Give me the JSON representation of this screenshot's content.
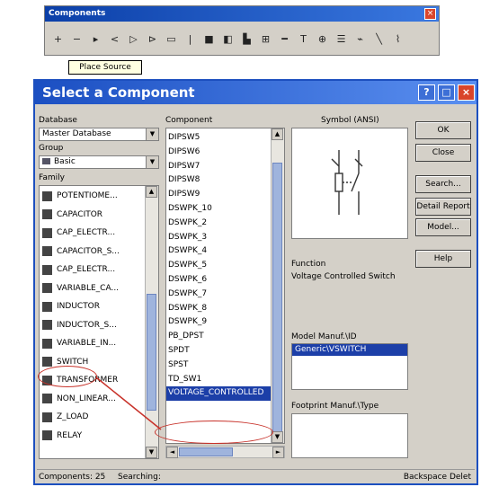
{
  "toolbar": {
    "title": "Components",
    "close_label": "×",
    "icons": [
      "plus-icon",
      "minus-icon",
      "diode-icon",
      "transistor-icon",
      "analog-icon",
      "ttl-icon",
      "cmos-icon",
      "misc-digital-icon",
      "mixed-icon",
      "indicator-icon",
      "power-icon",
      "misc-icon",
      "rf-icon",
      "electromech-icon",
      "ladder-icon",
      "mcu-icon",
      "bus-icon",
      "wire-icon",
      "probe-icon"
    ],
    "icon_glyphs": [
      "+",
      "−",
      "▸",
      "<",
      "▷",
      "⊳",
      "▭",
      "|",
      "■",
      "◧",
      "▙",
      "⊞",
      "━",
      "T",
      "⊕",
      "☰",
      "⌁",
      "╲",
      "⌇"
    ]
  },
  "tooltip": "Place Source",
  "window": {
    "title": "Select a Component",
    "database_label": "Database",
    "database_value": "Master Database",
    "group_label": "Group",
    "group_value": "Basic",
    "family_label": "Family",
    "families": [
      "POTENTIOME...",
      "CAPACITOR",
      "CAP_ELECTR...",
      "CAPACITOR_S...",
      "CAP_ELECTR...",
      "VARIABLE_CA...",
      "INDUCTOR",
      "INDUCTOR_S...",
      "VARIABLE_IN...",
      "SWITCH",
      "TRANSFORMER",
      "NON_LINEAR...",
      "Z_LOAD",
      "RELAY"
    ],
    "component_label": "Component",
    "components": [
      "DIPSW5",
      "DIPSW6",
      "DIPSW7",
      "DIPSW8",
      "DIPSW9",
      "DSWPK_10",
      "DSWPK_2",
      "DSWPK_3",
      "DSWPK_4",
      "DSWPK_5",
      "DSWPK_6",
      "DSWPK_7",
      "DSWPK_8",
      "DSWPK_9",
      "PB_DPST",
      "SPDT",
      "SPST",
      "TD_SW1",
      "VOLTAGE_CONTROLLED"
    ],
    "symbol_label": "Symbol (ANSI)",
    "function_label": "Function",
    "function_value": "Voltage Controlled Switch",
    "model_label": "Model Manuf.\\ID",
    "model_value": "Generic\\VSWITCH",
    "footprint_label": "Footprint Manuf.\\Type",
    "buttons": {
      "ok": "OK",
      "close": "Close",
      "search": "Search...",
      "detail": "Detail Report",
      "model": "Model...",
      "help": "Help"
    },
    "status": {
      "count": "Components: 25",
      "searching": "Searching:",
      "backspace": "Backspace Delet"
    }
  }
}
